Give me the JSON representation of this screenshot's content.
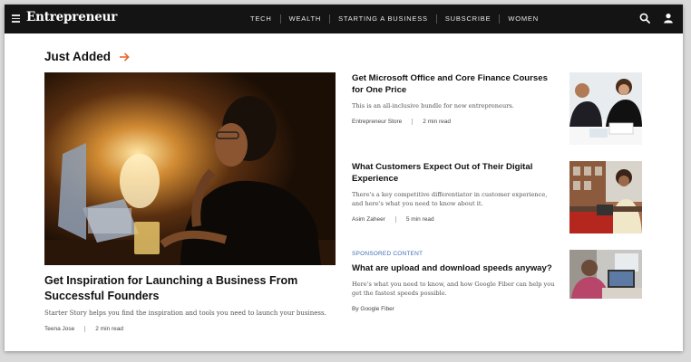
{
  "nav": {
    "logo": "Entrepreneur",
    "items": [
      "TECH",
      "WEALTH",
      "STARTING A BUSINESS",
      "SUBSCRIBE",
      "WOMEN"
    ],
    "icons": [
      "menu-icon",
      "search-icon",
      "user-icon"
    ]
  },
  "section": {
    "title": "Just Added",
    "accent_color": "#e8672e"
  },
  "hero": {
    "title": "Get Inspiration for Launching a Business From Successful Founders",
    "description": "Starter Story helps you find the inspiration and tools you need to launch your business.",
    "author": "Teena Jose",
    "read_time": "2 min read"
  },
  "articles": [
    {
      "title": "Get Microsoft Office and Core Finance Courses for One Price",
      "description": "This is an all-inclusive bundle for new entrepreneurs.",
      "author": "Entrepreneur Store",
      "read_time": "2 min read"
    },
    {
      "title": "What Customers Expect Out of Their Digital Experience",
      "description": "There's a key competitive differentiator in customer experience, and here's what you need to know about it.",
      "author": "Asim Zaheer",
      "read_time": "5 min read"
    },
    {
      "label": "SPONSORED CONTENT",
      "title": "What are upload and download speeds anyway?",
      "description": "Here's what you need to know, and how Google Fiber can help you get the fastest speeds possible.",
      "author": "By Google Fiber"
    }
  ]
}
